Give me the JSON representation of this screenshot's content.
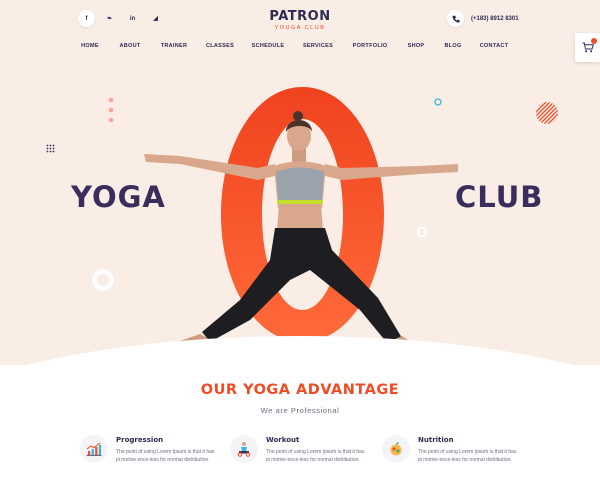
{
  "header": {
    "social": [
      {
        "icon": "facebook-icon",
        "glyph": "f"
      },
      {
        "icon": "twitter-icon",
        "glyph": "❧"
      },
      {
        "icon": "linkedin-icon",
        "glyph": "in"
      },
      {
        "icon": "rss-icon",
        "glyph": "◢"
      }
    ],
    "logo_title": "PATRON",
    "logo_subtitle": "YOUGA CLUB",
    "phone": "(+183) 8912 8301"
  },
  "nav": [
    "HOME",
    "ABOUT",
    "TRAINER",
    "CLASSES",
    "SCHEDULE",
    "SERVICES",
    "PORTFOLIO",
    "SHOP",
    "BLOG",
    "CONTACT"
  ],
  "cart": {
    "icon": "cart-icon"
  },
  "hero": {
    "word_left": "YOGA",
    "word_right": "CLUB",
    "accent_color": "#ef4b24",
    "heading_color": "#3a2d5c",
    "background": "#f9ede6"
  },
  "advantage": {
    "title": "OUR YOGA ADVANTAGE",
    "subtitle": "We are Professional",
    "features": [
      {
        "title": "Progression",
        "text": "The point of using Lorem Ipsum is that it has pi motive ence-less for normal distribution.",
        "icon": "chart-icon"
      },
      {
        "title": "Workout",
        "text": "The point of using Lorem Ipsum is that it has pi motive ence-less for normal distribution.",
        "icon": "workout-icon"
      },
      {
        "title": "Nutrition",
        "text": "The point of using Lorem Ipsum is that it has pi motive ence-less for normal distribution.",
        "icon": "nutrition-icon"
      }
    ]
  }
}
